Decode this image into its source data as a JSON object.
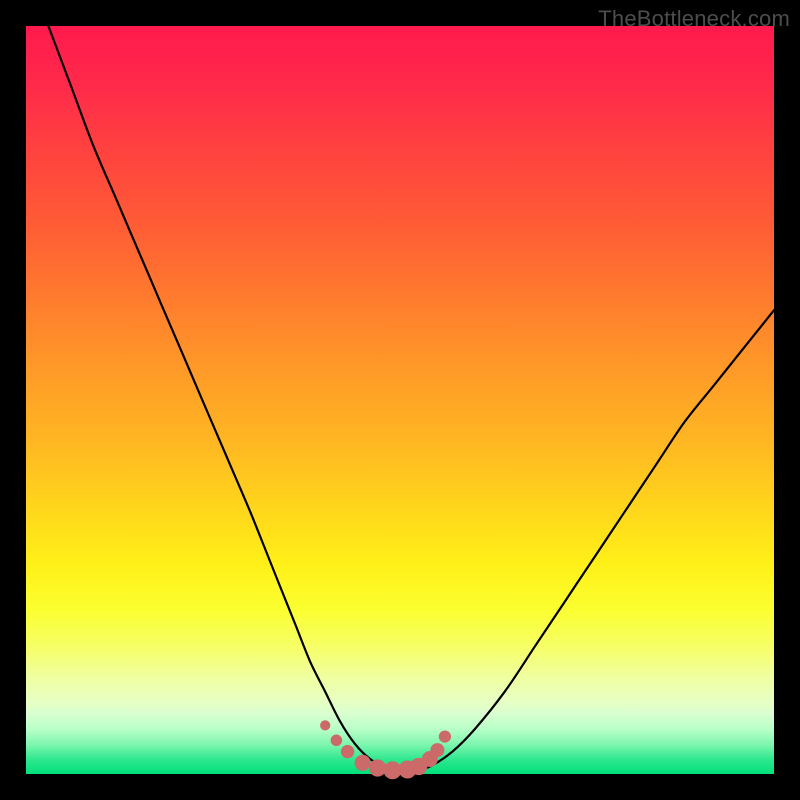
{
  "watermark": "TheBottleneck.com",
  "colors": {
    "frame": "#000000",
    "curve": "#000000",
    "marker_fill": "#cc6a6a",
    "marker_stroke": "#b95c5c"
  },
  "chart_data": {
    "type": "line",
    "title": "",
    "xlabel": "",
    "ylabel": "",
    "xlim": [
      0,
      100
    ],
    "ylim": [
      0,
      100
    ],
    "grid": false,
    "legend": false,
    "series": [
      {
        "name": "bottleneck-curve",
        "x": [
          3,
          6,
          9,
          12,
          15,
          18,
          21,
          24,
          27,
          30,
          32,
          34,
          36,
          38,
          40,
          42,
          44,
          46,
          48,
          50,
          52,
          54,
          57,
          60,
          64,
          68,
          72,
          76,
          80,
          84,
          88,
          92,
          96,
          100
        ],
        "y": [
          100,
          92,
          84,
          77,
          70,
          63,
          56,
          49,
          42,
          35,
          30,
          25,
          20,
          15,
          11,
          7,
          4,
          2,
          1,
          0.5,
          0.5,
          1,
          3,
          6,
          11,
          17,
          23,
          29,
          35,
          41,
          47,
          52,
          57,
          62
        ]
      }
    ],
    "markers": {
      "name": "valley-markers",
      "x": [
        40,
        41.5,
        43,
        45,
        47,
        49,
        51,
        52.5,
        54,
        55,
        56
      ],
      "y": [
        6.5,
        4.5,
        3,
        1.5,
        0.8,
        0.5,
        0.6,
        1,
        2,
        3.2,
        5
      ],
      "r": [
        3.2,
        3.6,
        4.2,
        5.0,
        5.4,
        5.6,
        5.6,
        5.4,
        5.0,
        4.4,
        3.8
      ]
    }
  }
}
